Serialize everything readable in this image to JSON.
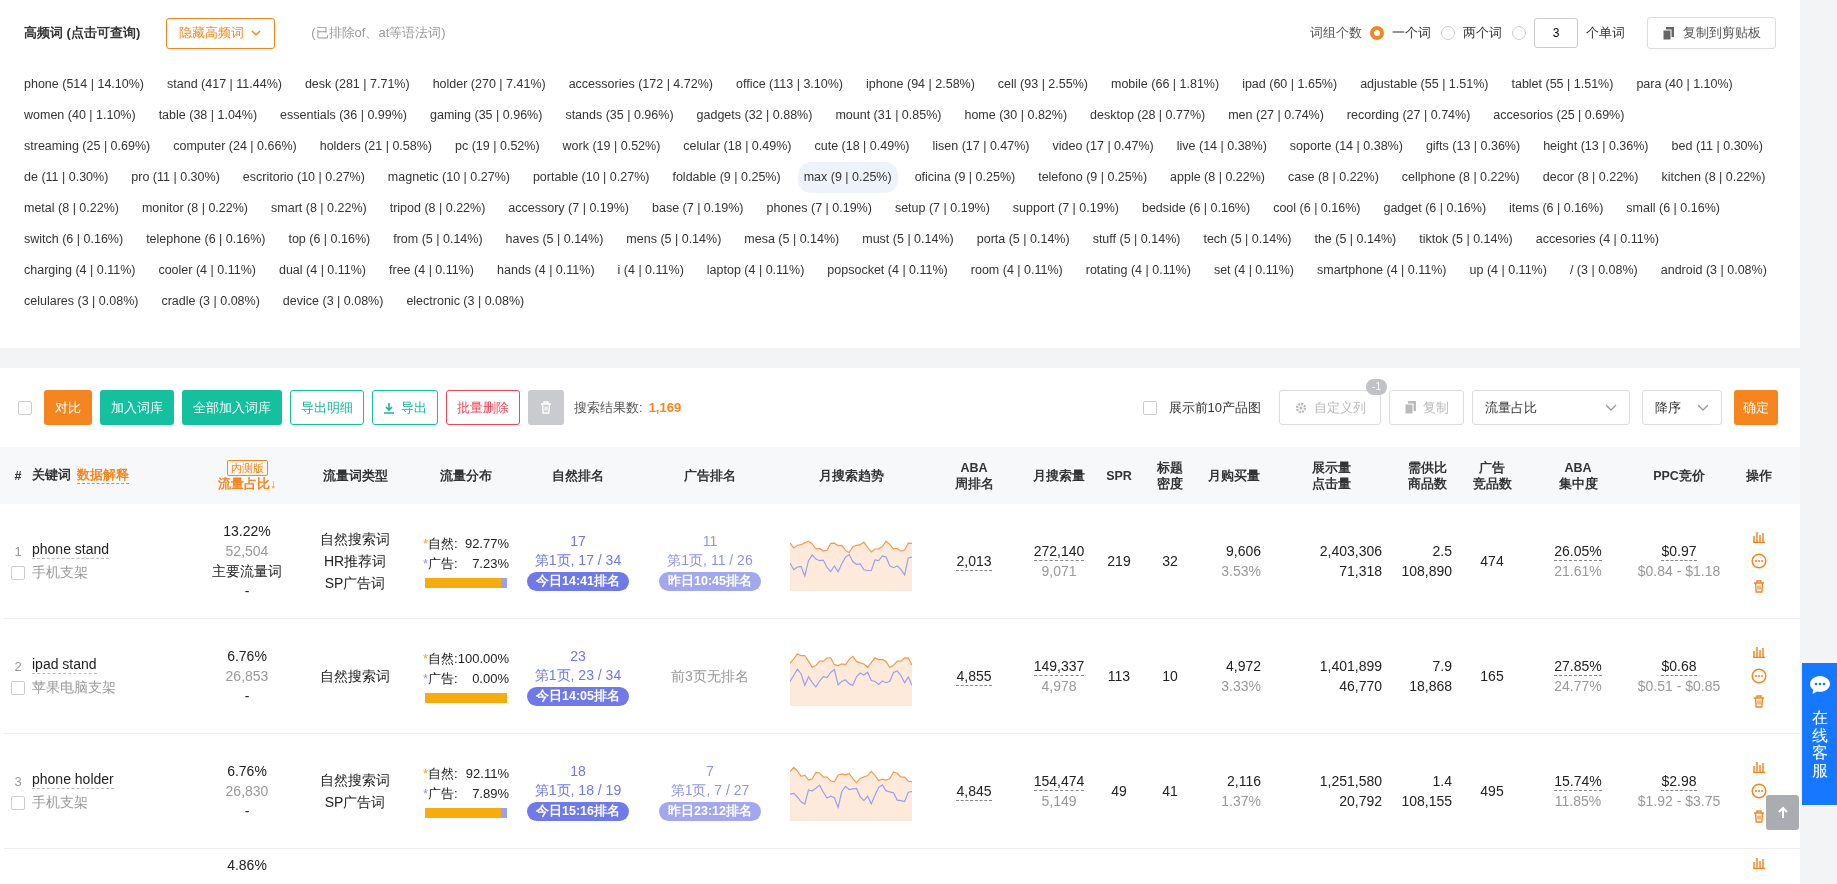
{
  "header": {
    "title": "高频词 (点击可查询)",
    "hide_button": "隐藏高频词",
    "note": "(已排除of、at等语法词)",
    "group_label": "词组个数",
    "group_options": [
      {
        "kind": "text",
        "label": "一个词",
        "selected": true
      },
      {
        "kind": "text",
        "label": "两个词",
        "selected": false
      },
      {
        "kind": "input",
        "value": "3",
        "label": "个单词",
        "selected": false
      }
    ],
    "copy_button": "复制到剪贴板"
  },
  "keywords": [
    {
      "text": "phone (514 | 14.10%)",
      "highlighted": false
    },
    {
      "text": "stand (417 | 11.44%)",
      "highlighted": false
    },
    {
      "text": "desk (281 | 7.71%)",
      "highlighted": false
    },
    {
      "text": "holder (270 | 7.41%)",
      "highlighted": false
    },
    {
      "text": "accessories (172 | 4.72%)",
      "highlighted": false
    },
    {
      "text": "office (113 | 3.10%)",
      "highlighted": false
    },
    {
      "text": "iphone (94 | 2.58%)",
      "highlighted": false
    },
    {
      "text": "cell (93 | 2.55%)",
      "highlighted": false
    },
    {
      "text": "mobile (66 | 1.81%)",
      "highlighted": false
    },
    {
      "text": "ipad (60 | 1.65%)",
      "highlighted": false
    },
    {
      "text": "adjustable (55 | 1.51%)",
      "highlighted": false
    },
    {
      "text": "tablet (55 | 1.51%)",
      "highlighted": false
    },
    {
      "text": "para (40 | 1.10%)",
      "highlighted": false
    },
    {
      "text": "women (40 | 1.10%)",
      "highlighted": false
    },
    {
      "text": "table (38 | 1.04%)",
      "highlighted": false
    },
    {
      "text": "essentials (36 | 0.99%)",
      "highlighted": false
    },
    {
      "text": "gaming (35 | 0.96%)",
      "highlighted": false
    },
    {
      "text": "stands (35 | 0.96%)",
      "highlighted": false
    },
    {
      "text": "gadgets (32 | 0.88%)",
      "highlighted": false
    },
    {
      "text": "mount (31 | 0.85%)",
      "highlighted": false
    },
    {
      "text": "home (30 | 0.82%)",
      "highlighted": false
    },
    {
      "text": "desktop (28 | 0.77%)",
      "highlighted": false
    },
    {
      "text": "men (27 | 0.74%)",
      "highlighted": false
    },
    {
      "text": "recording (27 | 0.74%)",
      "highlighted": false
    },
    {
      "text": "accesorios (25 | 0.69%)",
      "highlighted": false
    },
    {
      "text": "streaming (25 | 0.69%)",
      "highlighted": false
    },
    {
      "text": "computer (24 | 0.66%)",
      "highlighted": false
    },
    {
      "text": "holders (21 | 0.58%)",
      "highlighted": false
    },
    {
      "text": "pc (19 | 0.52%)",
      "highlighted": false
    },
    {
      "text": "work (19 | 0.52%)",
      "highlighted": false
    },
    {
      "text": "celular (18 | 0.49%)",
      "highlighted": false
    },
    {
      "text": "cute (18 | 0.49%)",
      "highlighted": false
    },
    {
      "text": "lisen (17 | 0.47%)",
      "highlighted": false
    },
    {
      "text": "video (17 | 0.47%)",
      "highlighted": false
    },
    {
      "text": "live (14 | 0.38%)",
      "highlighted": false
    },
    {
      "text": "soporte (14 | 0.38%)",
      "highlighted": false
    },
    {
      "text": "gifts (13 | 0.36%)",
      "highlighted": false
    },
    {
      "text": "height (13 | 0.36%)",
      "highlighted": false
    },
    {
      "text": "bed (11 | 0.30%)",
      "highlighted": false
    },
    {
      "text": "de (11 | 0.30%)",
      "highlighted": false
    },
    {
      "text": "pro (11 | 0.30%)",
      "highlighted": false
    },
    {
      "text": "escritorio (10 | 0.27%)",
      "highlighted": false
    },
    {
      "text": "magnetic (10 | 0.27%)",
      "highlighted": false
    },
    {
      "text": "portable (10 | 0.27%)",
      "highlighted": false
    },
    {
      "text": "foldable (9 | 0.25%)",
      "highlighted": false
    },
    {
      "text": "max (9 | 0.25%)",
      "highlighted": true
    },
    {
      "text": "oficina (9 | 0.25%)",
      "highlighted": false
    },
    {
      "text": "telefono (9 | 0.25%)",
      "highlighted": false
    },
    {
      "text": "apple (8 | 0.22%)",
      "highlighted": false
    },
    {
      "text": "case (8 | 0.22%)",
      "highlighted": false
    },
    {
      "text": "cellphone (8 | 0.22%)",
      "highlighted": false
    },
    {
      "text": "decor (8 | 0.22%)",
      "highlighted": false
    },
    {
      "text": "kitchen (8 | 0.22%)",
      "highlighted": false
    },
    {
      "text": "metal (8 | 0.22%)",
      "highlighted": false
    },
    {
      "text": "monitor (8 | 0.22%)",
      "highlighted": false
    },
    {
      "text": "smart (8 | 0.22%)",
      "highlighted": false
    },
    {
      "text": "tripod (8 | 0.22%)",
      "highlighted": false
    },
    {
      "text": "accessory (7 | 0.19%)",
      "highlighted": false
    },
    {
      "text": "base (7 | 0.19%)",
      "highlighted": false
    },
    {
      "text": "phones (7 | 0.19%)",
      "highlighted": false
    },
    {
      "text": "setup (7 | 0.19%)",
      "highlighted": false
    },
    {
      "text": "support (7 | 0.19%)",
      "highlighted": false
    },
    {
      "text": "bedside (6 | 0.16%)",
      "highlighted": false
    },
    {
      "text": "cool (6 | 0.16%)",
      "highlighted": false
    },
    {
      "text": "gadget (6 | 0.16%)",
      "highlighted": false
    },
    {
      "text": "items (6 | 0.16%)",
      "highlighted": false
    },
    {
      "text": "small (6 | 0.16%)",
      "highlighted": false
    },
    {
      "text": "switch (6 | 0.16%)",
      "highlighted": false
    },
    {
      "text": "telephone (6 | 0.16%)",
      "highlighted": false
    },
    {
      "text": "top (6 | 0.16%)",
      "highlighted": false
    },
    {
      "text": "from (5 | 0.14%)",
      "highlighted": false
    },
    {
      "text": "haves (5 | 0.14%)",
      "highlighted": false
    },
    {
      "text": "mens (5 | 0.14%)",
      "highlighted": false
    },
    {
      "text": "mesa (5 | 0.14%)",
      "highlighted": false
    },
    {
      "text": "must (5 | 0.14%)",
      "highlighted": false
    },
    {
      "text": "porta (5 | 0.14%)",
      "highlighted": false
    },
    {
      "text": "stuff (5 | 0.14%)",
      "highlighted": false
    },
    {
      "text": "tech (5 | 0.14%)",
      "highlighted": false
    },
    {
      "text": "the (5 | 0.14%)",
      "highlighted": false
    },
    {
      "text": "tiktok (5 | 0.14%)",
      "highlighted": false
    },
    {
      "text": "accesories (4 | 0.11%)",
      "highlighted": false
    },
    {
      "text": "charging (4 | 0.11%)",
      "highlighted": false
    },
    {
      "text": "cooler (4 | 0.11%)",
      "highlighted": false
    },
    {
      "text": "dual (4 | 0.11%)",
      "highlighted": false
    },
    {
      "text": "free (4 | 0.11%)",
      "highlighted": false
    },
    {
      "text": "hands (4 | 0.11%)",
      "highlighted": false
    },
    {
      "text": "i (4 | 0.11%)",
      "highlighted": false
    },
    {
      "text": "laptop (4 | 0.11%)",
      "highlighted": false
    },
    {
      "text": "popsocket (4 | 0.11%)",
      "highlighted": false
    },
    {
      "text": "room (4 | 0.11%)",
      "highlighted": false
    },
    {
      "text": "rotating (4 | 0.11%)",
      "highlighted": false
    },
    {
      "text": "set (4 | 0.11%)",
      "highlighted": false
    },
    {
      "text": "smartphone (4 | 0.11%)",
      "highlighted": false
    },
    {
      "text": "up (4 | 0.11%)",
      "highlighted": false
    },
    {
      "text": "/ (3 | 0.08%)",
      "highlighted": false
    },
    {
      "text": "android (3 | 0.08%)",
      "highlighted": false
    },
    {
      "text": "celulares (3 | 0.08%)",
      "highlighted": false
    },
    {
      "text": "cradle (3 | 0.08%)",
      "highlighted": false
    },
    {
      "text": "device (3 | 0.08%)",
      "highlighted": false
    },
    {
      "text": "electronic (3 | 0.08%)",
      "highlighted": false
    }
  ],
  "toolbar": {
    "select_all": {
      "checked": false
    },
    "buttons": [
      {
        "kind": "orange",
        "label": "对比"
      },
      {
        "kind": "green",
        "label": "加入词库"
      },
      {
        "kind": "green",
        "label": "全部加入词库"
      },
      {
        "kind": "outline-green",
        "label": "导出明细"
      },
      {
        "kind": "download",
        "label": "导出"
      },
      {
        "kind": "outline-red",
        "label": "批量删除"
      },
      {
        "kind": "trash"
      }
    ],
    "result_label": "搜索结果数:",
    "result_count": "1,169",
    "show_images": {
      "label": "展示前10产品图",
      "checked": false
    },
    "custom_columns": {
      "label": "自定义列",
      "badge": "-1",
      "disabled": true
    },
    "copy": {
      "label": "复制",
      "disabled": true
    },
    "sort_field": "流量占比",
    "sort_order": "降序",
    "confirm": "确定"
  },
  "table": {
    "columns": [
      {
        "lines": [
          "#"
        ]
      },
      {
        "lines": [
          "关键词"
        ],
        "link": "数据解释"
      },
      {
        "lines": [
          "流量占比"
        ],
        "badge": "内测版",
        "sort": "↓"
      },
      {
        "lines": [
          "流量词类型"
        ]
      },
      {
        "lines": [
          "流量分布"
        ]
      },
      {
        "lines": [
          "自然排名"
        ]
      },
      {
        "lines": [
          "广告排名"
        ]
      },
      {
        "lines": [
          "月搜索趋势"
        ]
      },
      {
        "lines": [
          "ABA",
          "周排名"
        ]
      },
      {
        "lines": [
          "月搜索量"
        ]
      },
      {
        "lines": [
          "SPR"
        ]
      },
      {
        "lines": [
          "标题",
          "密度"
        ]
      },
      {
        "lines": [
          "月购买量"
        ]
      },
      {
        "lines": [
          "展示量",
          "点击量"
        ]
      },
      {
        "lines": [
          "需供比",
          "商品数"
        ]
      },
      {
        "lines": [
          "广告",
          "竞品数"
        ]
      },
      {
        "lines": [
          "ABA",
          "集中度"
        ]
      },
      {
        "lines": [
          "PPC竞价"
        ]
      },
      {
        "lines": [
          "操作"
        ]
      }
    ],
    "rows": [
      {
        "kind": "full",
        "index": "1",
        "checked": false,
        "keyword": "phone stand",
        "translation": "手机支架",
        "share": "13.22%",
        "share_count": "52,504",
        "share_tag": "主要流量词",
        "share_extra": "-",
        "types": [
          "自然搜索词",
          "HR推荐词",
          "SP广告词"
        ],
        "distribution": {
          "natural_marker": "*",
          "natural_label": "自然:",
          "natural": "92.77%",
          "ad_marker": "*",
          "ad_label": "广告:",
          "ad": "7.23%",
          "level": 0.9277
        },
        "natural_rank": {
          "kind": "ranked",
          "rank": "17",
          "page": "第1页, 17 / 34",
          "badge": "今日14:41排名"
        },
        "ad_rank": {
          "kind": "ranked",
          "rank": "11",
          "page": "第1页, 11 / 26",
          "badge": "昨日10:45排名"
        },
        "aba": "2,013",
        "monthly_search": "272,140",
        "search_sub": "9,071",
        "spr": "219",
        "title_density": "32",
        "monthly_purchase": "9,606",
        "purchase_rate": "3.53%",
        "impressions": "2,403,306",
        "clicks": "71,318",
        "supply_demand": "2.5",
        "product_count": "108,890",
        "ad_competitors": "474",
        "aba_concentration": "26.05%",
        "concentration_sub": "21.61%",
        "ppc": "$0.97",
        "ppc_range": "$0.84 - $1.18"
      },
      {
        "kind": "full",
        "index": "2",
        "checked": false,
        "keyword": "ipad stand",
        "translation": "苹果电脑支架",
        "share": "6.76%",
        "share_count": "26,853",
        "share_extra": "-",
        "types": [
          "自然搜索词"
        ],
        "distribution": {
          "natural_marker": "*",
          "natural_label": "自然:",
          "natural": "100.00%",
          "ad_marker": "*",
          "ad_label": "广告:",
          "ad": "0.00%",
          "level": 1
        },
        "natural_rank": {
          "kind": "ranked",
          "rank": "23",
          "page": "第1页, 23 / 34",
          "badge": "今日14:05排名"
        },
        "ad_rank": {
          "kind": "none",
          "text": "前3页无排名"
        },
        "aba": "4,855",
        "monthly_search": "149,337",
        "search_sub": "4,978",
        "spr": "113",
        "title_density": "10",
        "monthly_purchase": "4,972",
        "purchase_rate": "3.33%",
        "impressions": "1,401,899",
        "clicks": "46,770",
        "supply_demand": "7.9",
        "product_count": "18,868",
        "ad_competitors": "165",
        "aba_concentration": "27.85%",
        "concentration_sub": "24.77%",
        "ppc": "$0.68",
        "ppc_range": "$0.51 - $0.85"
      },
      {
        "kind": "full",
        "index": "3",
        "checked": false,
        "keyword": "phone holder",
        "translation": "手机支架",
        "share": "6.76%",
        "share_count": "26,830",
        "share_extra": "-",
        "types": [
          "自然搜索词",
          "SP广告词"
        ],
        "distribution": {
          "natural_marker": "*",
          "natural_label": "自然:",
          "natural": "92.11%",
          "ad_marker": "*",
          "ad_label": "广告:",
          "ad": "7.89%",
          "level": 0.9211
        },
        "natural_rank": {
          "kind": "ranked",
          "rank": "18",
          "page": "第1页, 18 / 19",
          "badge": "今日15:16排名"
        },
        "ad_rank": {
          "kind": "ranked",
          "rank": "7",
          "page": "第1页, 7 / 27",
          "badge": "昨日23:12排名"
        },
        "aba": "4,845",
        "monthly_search": "154,474",
        "search_sub": "5,149",
        "spr": "49",
        "title_density": "41",
        "monthly_purchase": "2,116",
        "purchase_rate": "1.37%",
        "impressions": "1,251,580",
        "clicks": "20,792",
        "supply_demand": "1.4",
        "product_count": "108,155",
        "ad_competitors": "495",
        "aba_concentration": "15.74%",
        "concentration_sub": "11.85%",
        "ppc": "$2.98",
        "ppc_range": "$1.92 - $3.75"
      },
      {
        "kind": "partial",
        "share": "4.86%"
      }
    ]
  },
  "float": {
    "support": "在线客服"
  }
}
